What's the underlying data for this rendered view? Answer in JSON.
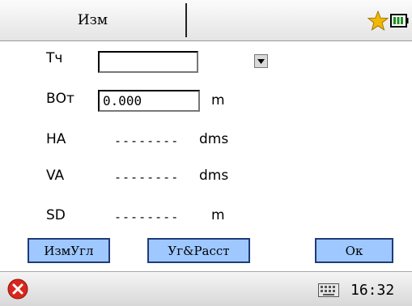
{
  "header": {
    "title": "Изм",
    "favorite_icon": "star-icon",
    "battery_icon": "battery-icon"
  },
  "fields": {
    "tch": {
      "label": "Тч",
      "value": ""
    },
    "vot": {
      "label": "ВОт",
      "value": "0.000",
      "unit": "m"
    },
    "ha": {
      "label": "HA",
      "value": "--------",
      "unit": "dms"
    },
    "va": {
      "label": "VA",
      "value": "--------",
      "unit": "dms"
    },
    "sd": {
      "label": "SD",
      "value": "--------",
      "unit": "m"
    }
  },
  "buttons": {
    "measure_angle": "ИзмУгл",
    "angle_distance": "Уг&Расст",
    "ok": "Ок"
  },
  "taskbar": {
    "close_icon": "close-icon",
    "keyboard_icon": "keyboard-icon",
    "time": "16:32"
  },
  "colors": {
    "button_fill": "#9ec8ff",
    "button_border": "#1f3b77",
    "star": "#f2b705",
    "battery": "#1e8f1e",
    "close": "#d9261c"
  }
}
